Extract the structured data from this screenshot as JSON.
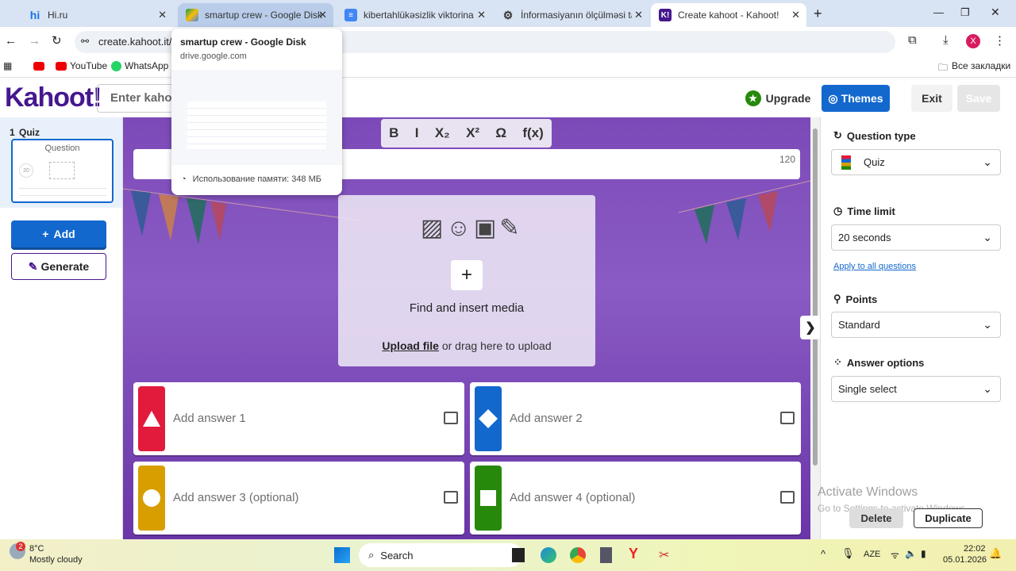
{
  "browser": {
    "tabs": [
      {
        "title": "Hi.ru",
        "icon": "hi-icon"
      },
      {
        "title": "smartup crew - Google Disk",
        "icon": "google-drive-icon"
      },
      {
        "title": "kibertahlükəsizlik viktorina - Go",
        "icon": "google-docs-icon"
      },
      {
        "title": "İnformasiyanın ölçülməsi tapşır",
        "icon": "chatgpt-icon"
      },
      {
        "title": "Create kahoot - Kahoot!",
        "icon": "kahoot-icon"
      }
    ],
    "url": "create.kahoot.it/cr",
    "bookmarks": [
      "YouTube",
      "WhatsApp"
    ],
    "all_bookmarks": "Все закладки",
    "profile_initial": "X"
  },
  "tab_preview": {
    "title": "smartup crew - Google Disk",
    "domain": "drive.google.com",
    "memory": "Использование памяти: 348 МБ"
  },
  "header": {
    "logo": "Kahoot!",
    "pin_placeholder": "Enter kahoot",
    "upgrade": "Upgrade",
    "themes": "Themes",
    "exit": "Exit",
    "save": "Save"
  },
  "sidebar": {
    "slide_number": "1",
    "slide_type": "Quiz",
    "slide_title": "Question",
    "slide_time": "20",
    "add": "Add",
    "generate": "Generate"
  },
  "editor": {
    "toolbar": [
      "B",
      "I",
      "X₂",
      "X²",
      "Ω",
      "f(x)"
    ],
    "char_count": "120",
    "media": {
      "find": "Find and insert media",
      "upload": "Upload file",
      "drag": "or drag here to upload"
    },
    "answers": [
      {
        "label": "Add answer 1",
        "color": "#e21b3c",
        "shape": "triangle"
      },
      {
        "label": "Add answer 2",
        "color": "#1368ce",
        "shape": "diamond"
      },
      {
        "label": "Add answer 3 (optional)",
        "color": "#d89e00",
        "shape": "circle"
      },
      {
        "label": "Add answer 4 (optional)",
        "color": "#26890c",
        "shape": "square"
      }
    ]
  },
  "settings": {
    "question_type_label": "Question type",
    "question_type": "Quiz",
    "time_limit_label": "Time limit",
    "time_limit": "20 seconds",
    "apply_all": "Apply to all questions",
    "points_label": "Points",
    "points": "Standard",
    "answer_options_label": "Answer options",
    "answer_options": "Single select",
    "delete": "Delete",
    "duplicate": "Duplicate"
  },
  "watermark": {
    "title": "Activate Windows",
    "sub": "Go to Settings to activate Windows."
  },
  "taskbar": {
    "temp": "8°C",
    "weather": "Mostly cloudy",
    "weather_badge": "2",
    "search": "Search",
    "lang": "AZE",
    "time": "22:02",
    "date": "05.01.2026"
  }
}
